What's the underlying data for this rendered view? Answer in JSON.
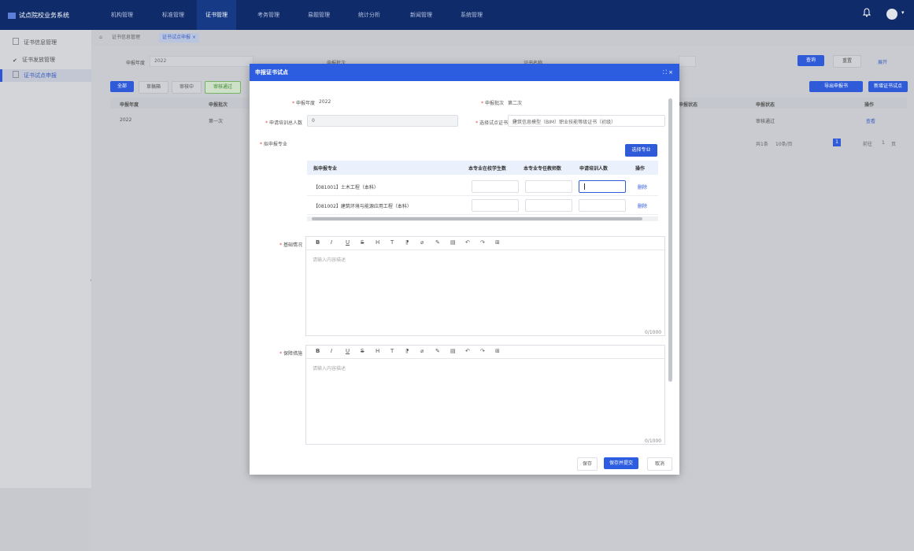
{
  "app": {
    "title": "试点院校业务系统"
  },
  "nav": {
    "items": [
      "机构管理",
      "标准管理",
      "证书管理",
      "考务管理",
      "易题管理",
      "统计分析",
      "新闻管理",
      "系统管理"
    ],
    "active_index": 2
  },
  "sidebar": {
    "items": [
      "证书信息管理",
      "证书发放管理",
      "证书试点申报"
    ],
    "active_index": 2
  },
  "tabs": {
    "items": [
      "证书信息管理",
      "证书试点申报"
    ],
    "home_glyph": "⌂",
    "close_glyph": "×"
  },
  "filters": {
    "year_label": "申报年度",
    "year_value": "2022",
    "batch_label": "申报批次",
    "cert_label": "证书名称"
  },
  "filter_buttons": {
    "search": "查询",
    "reset": "重置",
    "expand": "展开"
  },
  "action_buttons": {
    "all": "全部",
    "draft": "草稿箱",
    "reviewing": "审核中",
    "approved": "审核通过"
  },
  "right_buttons": {
    "export": "导出申报书",
    "declare": "新增证书试点"
  },
  "bg_table": {
    "headers": [
      "申报年度",
      "申报批次",
      "申报状态",
      "申报状态",
      "操作"
    ],
    "row": [
      "2022",
      "第一次",
      "审核通过",
      "审核通过",
      "查看"
    ]
  },
  "pager": {
    "total": "共1条",
    "per_page": "10条/页",
    "current": "1",
    "goto": "前往",
    "goto_page": "1",
    "page_suffix": "页"
  },
  "modal": {
    "title": "申报证书试点",
    "tools": "⛶ ×",
    "year_label": "申报年度",
    "year_value": "2022",
    "batch_label": "申报批次",
    "batch_value": "第二次",
    "count_label": "申请培训总人数",
    "count_value": "0",
    "cert_label": "选择试点证书",
    "cert_value": "建筑信息模型（BIM）职业技能等级证书（初级）",
    "major_label": "拟申报专业",
    "select_major_btn": "选择专业",
    "table_headers": [
      "拟申报专业",
      "本专业在校学生数",
      "本专业专任教师数",
      "申请培训人数",
      "操作"
    ],
    "rows": [
      {
        "major": "【081001】土木工程（本科）",
        "action": "删除"
      },
      {
        "major": "【081002】建筑环境与能源应用工程（本科）",
        "action": "删除"
      }
    ],
    "basic_label": "基础情况",
    "support_label": "保障措施",
    "editor_placeholder": "请输入内容描述",
    "editor_count": "0/1000",
    "editor_tools": [
      "B",
      "I",
      "U",
      "S",
      "H",
      "T",
      "⁋",
      "⌀",
      "✎",
      "▤",
      "↶",
      "↷",
      "⊞"
    ],
    "footer": {
      "save": "保存",
      "save_submit": "保存并提交",
      "cancel": "取消"
    }
  },
  "colors": {
    "primary": "#2c5de0",
    "nav_bg": "#0f2b6a",
    "danger": "#e0463b"
  }
}
